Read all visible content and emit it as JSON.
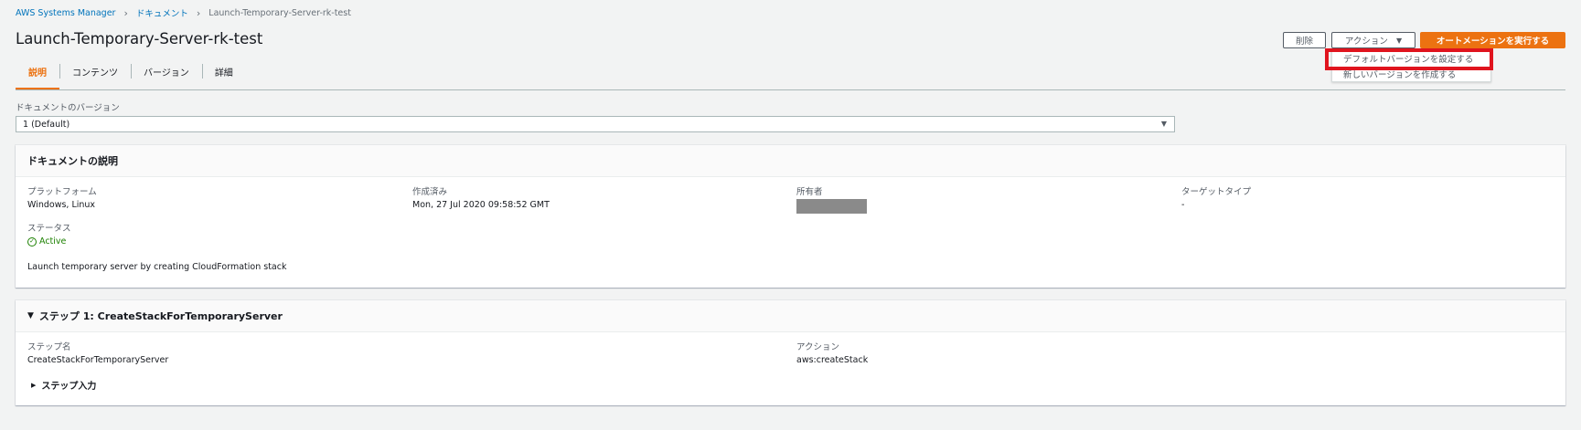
{
  "breadcrumb": {
    "items": [
      "AWS Systems Manager",
      "ドキュメント",
      "Launch-Temporary-Server-rk-test"
    ]
  },
  "page_title": "Launch-Temporary-Server-rk-test",
  "tabs": [
    {
      "label": "説明",
      "active": true
    },
    {
      "label": "コンテンツ",
      "active": false
    },
    {
      "label": "バージョン",
      "active": false
    },
    {
      "label": "詳細",
      "active": false
    }
  ],
  "header_buttons": {
    "delete_label": "削除",
    "actions_label": "アクション",
    "run_label": "オートメーションを実行する"
  },
  "actions_menu": {
    "items": [
      "デフォルトバージョンを設定する",
      "新しいバージョンを作成する"
    ],
    "highlighted_index": 0
  },
  "version": {
    "label": "ドキュメントのバージョン",
    "selected": "1 (Default)"
  },
  "document_description": {
    "title": "ドキュメントの説明",
    "platform_label": "プラットフォーム",
    "platform_value": "Windows, Linux",
    "created_label": "作成済み",
    "created_value": "Mon, 27 Jul 2020 09:58:52 GMT",
    "owner_label": "所有者",
    "target_label": "ターゲットタイプ",
    "target_value": "-",
    "status_label": "ステータス",
    "status_value": "Active",
    "description": "Launch temporary server by creating CloudFormation stack"
  },
  "step": {
    "title": "ステップ 1: CreateStackForTemporaryServer",
    "name_label": "ステップ名",
    "name_value": "CreateStackForTemporaryServer",
    "action_label": "アクション",
    "action_value": "aws:createStack",
    "input_label": "ステップ入力"
  },
  "colors": {
    "accent": "#ec7211",
    "link": "#0073bb",
    "success": "#1d8102",
    "highlight": "#e0141e"
  }
}
